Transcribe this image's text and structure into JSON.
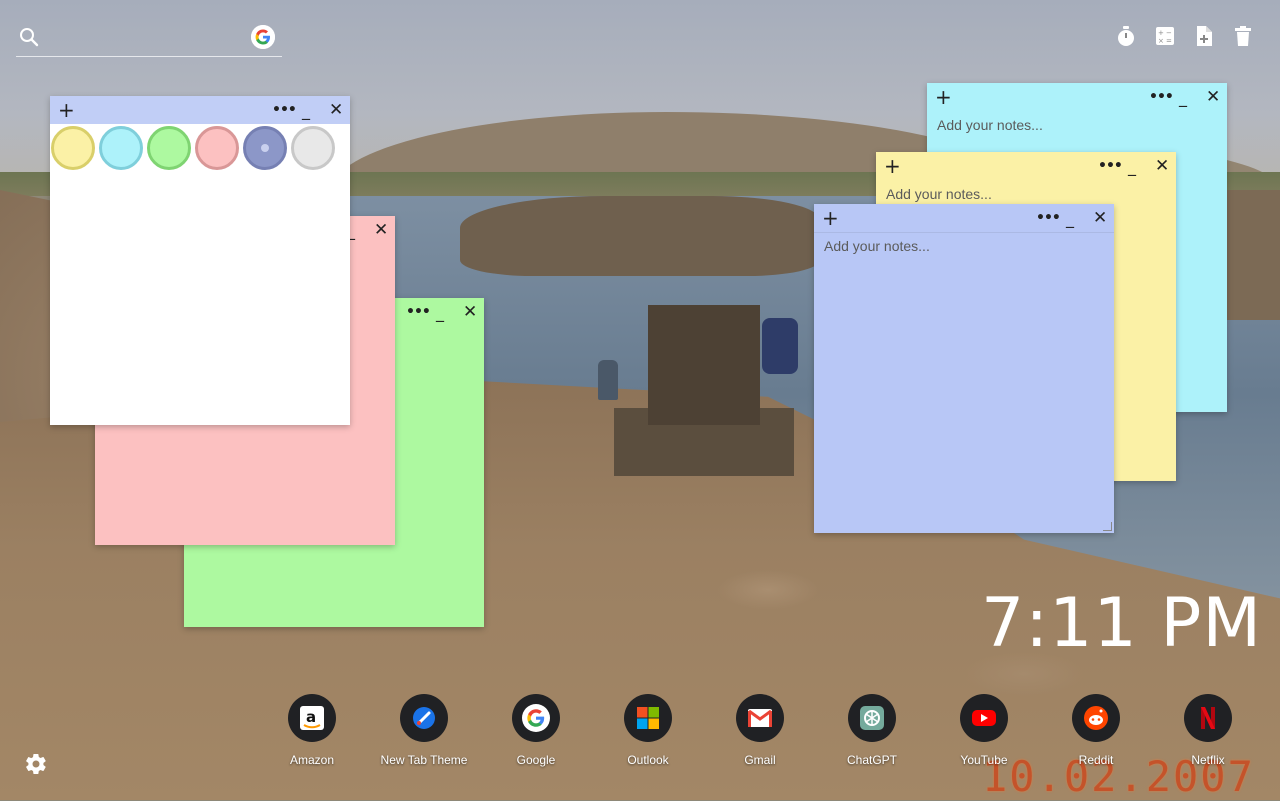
{
  "search": {
    "placeholder": ""
  },
  "toolbar": [
    {
      "name": "timer-icon"
    },
    {
      "name": "calculator-icon"
    },
    {
      "name": "add-note-icon"
    },
    {
      "name": "trash-icon"
    }
  ],
  "notes": {
    "placeholder": "Add your notes...",
    "plus": "+",
    "dots": "•••",
    "minimize": "_",
    "close": "✕"
  },
  "swatches": [
    {
      "fill": "#fbf1a6",
      "border": "#d9cf6a"
    },
    {
      "fill": "#adf2fa",
      "border": "#7fcfdb"
    },
    {
      "fill": "#adf9a0",
      "border": "#7fd472"
    },
    {
      "fill": "#fcc1c1",
      "border": "#d99797"
    },
    {
      "fill": "#8c97c8",
      "border": "#7680b3"
    },
    {
      "fill": "#e8e8e8",
      "border": "#c8c8c8"
    }
  ],
  "clock": {
    "time": "7:11 PM"
  },
  "photo_date": "10.02.2007",
  "dock": [
    {
      "label": "Amazon",
      "icon": "amazon-icon"
    },
    {
      "label": "New Tab Theme",
      "icon": "new-tab-theme-icon"
    },
    {
      "label": "Google",
      "icon": "google-icon"
    },
    {
      "label": "Outlook",
      "icon": "outlook-icon"
    },
    {
      "label": "Gmail",
      "icon": "gmail-icon"
    },
    {
      "label": "ChatGPT",
      "icon": "chatgpt-icon"
    },
    {
      "label": "YouTube",
      "icon": "youtube-icon"
    },
    {
      "label": "Reddit",
      "icon": "reddit-icon"
    },
    {
      "label": "Netflix",
      "icon": "netflix-icon"
    }
  ]
}
